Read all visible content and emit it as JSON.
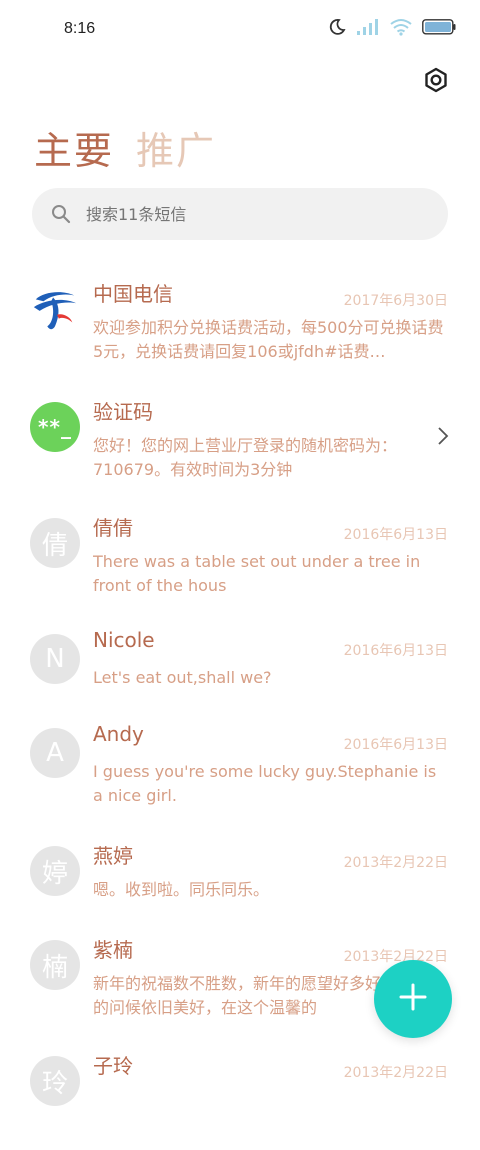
{
  "status": {
    "time": "8:16"
  },
  "tabs": [
    {
      "label": "主要"
    },
    {
      "label": "推广"
    }
  ],
  "search": {
    "placeholder": "搜索11条短信"
  },
  "conversations": [
    {
      "avatar": "",
      "name": "中国电信",
      "date": "2017年6月30日",
      "preview": "欢迎参加积分兑换话费活动，每500分可兑换话费5元，兑换话费请回复106或jfdh#话费…"
    },
    {
      "avatar": "**_",
      "name": "验证码",
      "date": "",
      "preview": "您好！您的网上营业厅登录的随机密码为：710679。有效时间为3分钟"
    },
    {
      "avatar": "倩",
      "name": "倩倩",
      "date": "2016年6月13日",
      "preview": "There was a table set out under a tree in front of the hous"
    },
    {
      "avatar": "N",
      "name": "Nicole",
      "date": "2016年6月13日",
      "preview": "Let's eat out,shall we?"
    },
    {
      "avatar": "A",
      "name": "Andy",
      "date": "2016年6月13日",
      "preview": "I guess you're some lucky guy.Stephanie is a nice girl."
    },
    {
      "avatar": "婷",
      "name": "燕婷",
      "date": "2013年2月22日",
      "preview": "嗯。收到啦。同乐同乐。"
    },
    {
      "avatar": "楠",
      "name": "紫楠",
      "date": "2013年2月22日",
      "preview": "新年的祝福数不胜数，新年的愿望好多好多，新年的问候依旧美好，在这个温馨的"
    },
    {
      "avatar": "玲",
      "name": "子玲",
      "date": "2013年2月22日",
      "preview": ""
    }
  ],
  "colors": {
    "accent": "#b66a4f",
    "tab_inactive": "#e6c8b6",
    "fab": "#1dd1c4",
    "verify_avatar": "#6cd25a"
  },
  "icons": {
    "settings": "settings-icon",
    "search": "search-icon",
    "fab": "plus-icon"
  }
}
